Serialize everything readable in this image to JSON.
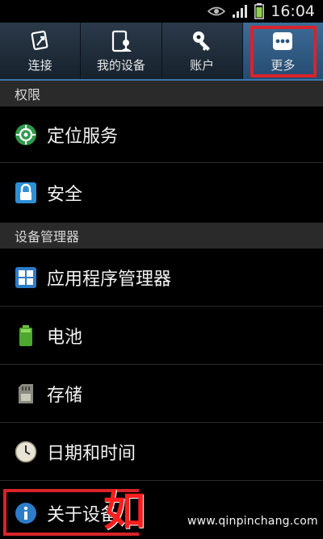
{
  "status_bar": {
    "time": "16:04",
    "icons": [
      "eye-icon",
      "signal-icon",
      "battery-icon"
    ]
  },
  "tabs": [
    {
      "label": "连接",
      "icon": "connection-icon",
      "active": false
    },
    {
      "label": "我的设备",
      "icon": "my-device-icon",
      "active": false
    },
    {
      "label": "账户",
      "icon": "account-key-icon",
      "active": false
    },
    {
      "label": "更多",
      "icon": "more-dots-icon",
      "active": true
    }
  ],
  "sections": [
    {
      "header": "权限",
      "items": [
        {
          "label": "定位服务",
          "icon": "location-icon"
        },
        {
          "label": "安全",
          "icon": "lock-icon"
        }
      ]
    },
    {
      "header": "设备管理器",
      "items": [
        {
          "label": "应用程序管理器",
          "icon": "app-grid-icon"
        },
        {
          "label": "电池",
          "icon": "battery-icon"
        },
        {
          "label": "存储",
          "icon": "sd-card-icon"
        },
        {
          "label": "日期和时间",
          "icon": "clock-icon"
        },
        {
          "label": "关于设备",
          "icon": "info-icon"
        }
      ]
    }
  ],
  "overlay": {
    "char": "如"
  },
  "watermark": "www.qinpinchang.com",
  "colors": {
    "highlight": "#d9232a",
    "active_tab": "#3d6c97",
    "section_bg": "#2a2a2a"
  }
}
